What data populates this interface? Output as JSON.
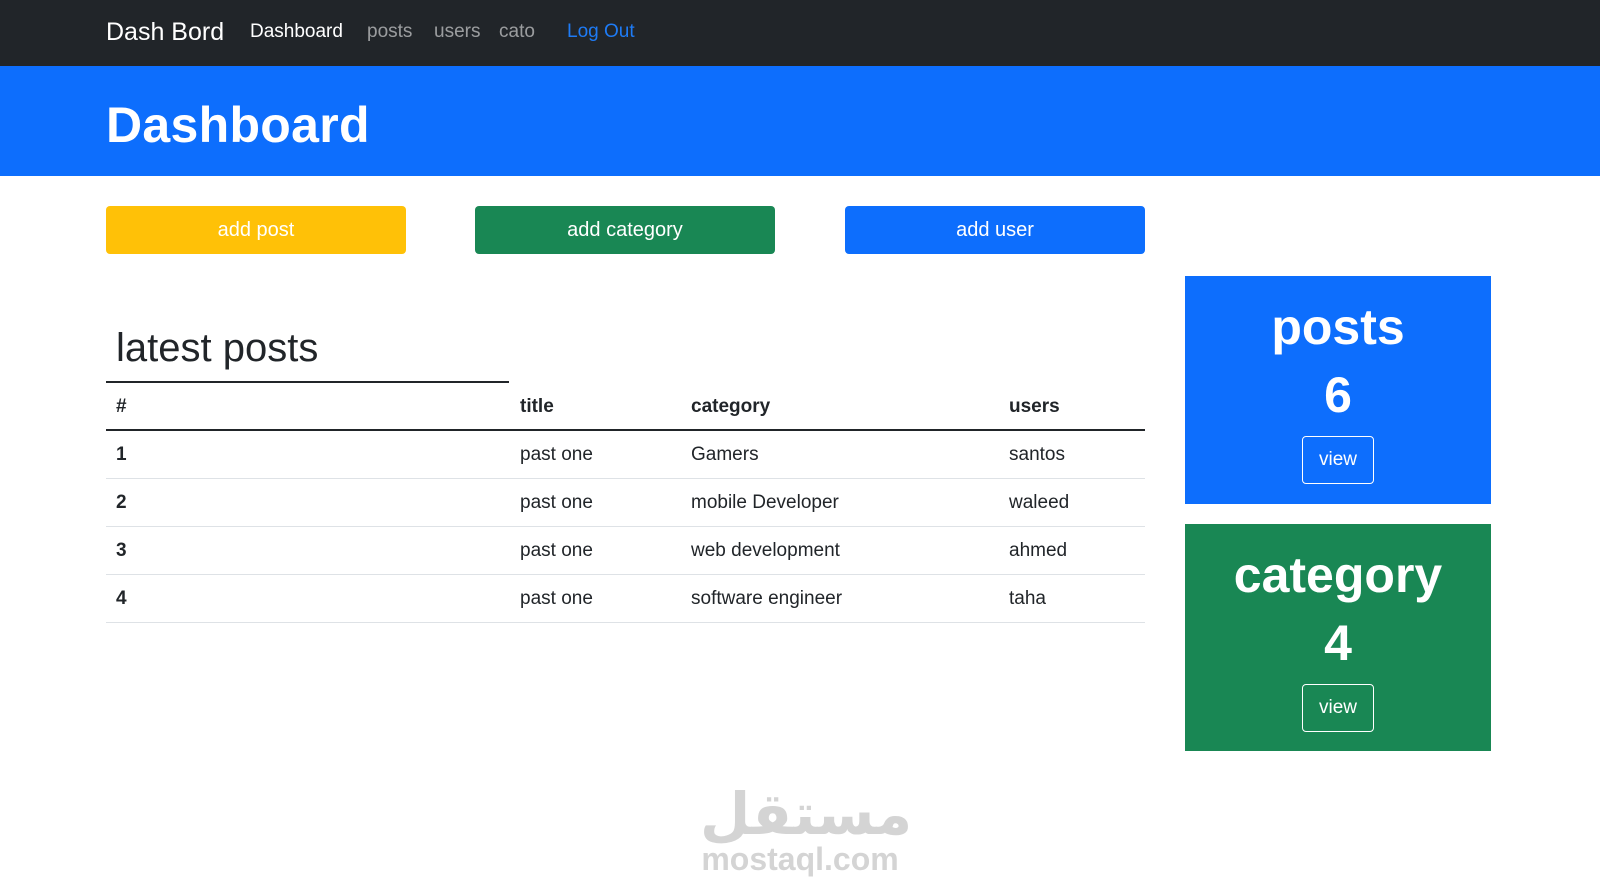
{
  "navbar": {
    "brand": "Dash Bord",
    "links": [
      "Dashboard",
      "posts",
      "users",
      "cato",
      "Log Out"
    ]
  },
  "hero": {
    "title": "Dashboard"
  },
  "actions": {
    "add_post": "add post",
    "add_category": "add category",
    "add_user": "add user"
  },
  "latest": {
    "title": "latest posts",
    "columns": [
      "#",
      "title",
      "category",
      "users"
    ],
    "rows": [
      [
        "1",
        "past one",
        "Gamers",
        "santos"
      ],
      [
        "2",
        "past one",
        "mobile Developer",
        "waleed"
      ],
      [
        "3",
        "past one",
        "web development",
        "ahmed"
      ],
      [
        "4",
        "past one",
        "software engineer",
        "taha"
      ]
    ]
  },
  "cards": {
    "posts": {
      "title": "posts",
      "count": "6",
      "button": "view"
    },
    "category": {
      "title": "category",
      "count": "4",
      "button": "view"
    }
  },
  "watermark": {
    "arabic": "مستقل",
    "latin": "mostaql.com"
  },
  "colors": {
    "navbar": "#212529",
    "primary": "#0d6efd",
    "warning": "#ffc107",
    "success": "#198754",
    "logout_link": "#1e7bf5"
  }
}
